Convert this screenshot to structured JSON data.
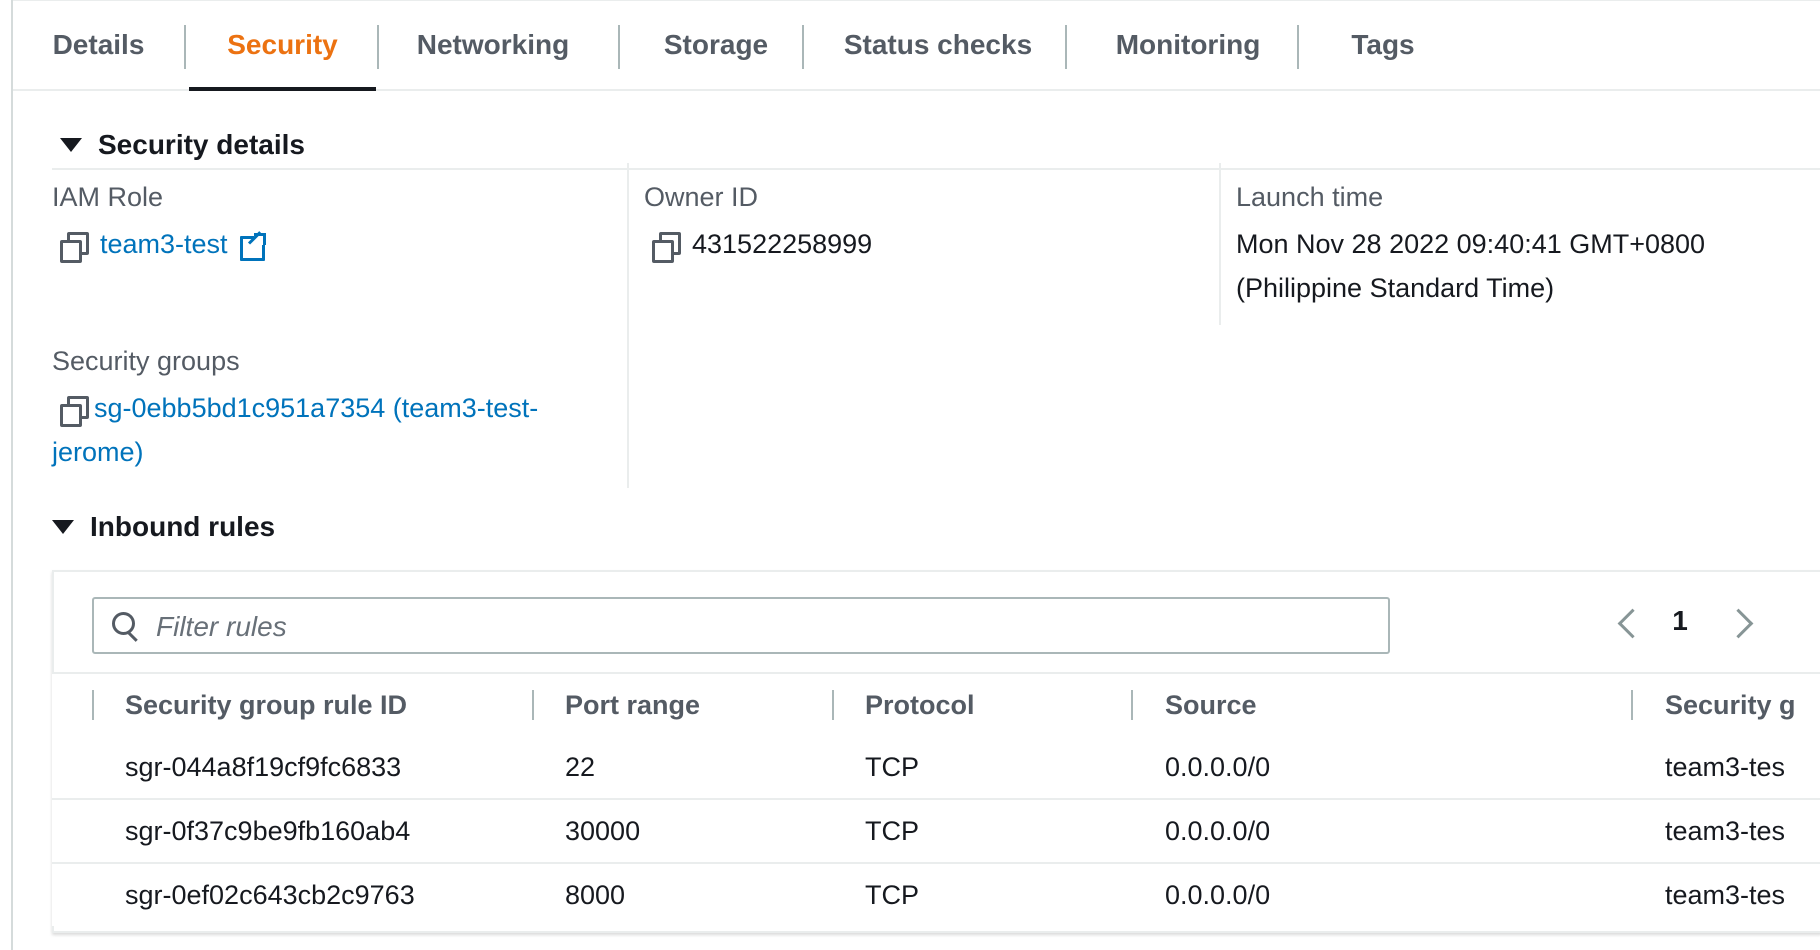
{
  "tabs": [
    {
      "label": "Details",
      "active": false
    },
    {
      "label": "Security",
      "active": true
    },
    {
      "label": "Networking",
      "active": false
    },
    {
      "label": "Storage",
      "active": false
    },
    {
      "label": "Status checks",
      "active": false
    },
    {
      "label": "Monitoring",
      "active": false
    },
    {
      "label": "Tags",
      "active": false
    }
  ],
  "security_details": {
    "heading": "Security details",
    "iam_role": {
      "label": "IAM Role",
      "value": "team3-test"
    },
    "owner_id": {
      "label": "Owner ID",
      "value": "431522258999"
    },
    "launch_time": {
      "label": "Launch time",
      "line1": "Mon Nov 28 2022 09:40:41 GMT+0800",
      "line2": "(Philippine Standard Time)"
    },
    "security_groups": {
      "label": "Security groups",
      "line1": "sg-0ebb5bd1c951a7354 (team3-test-",
      "line2": "jerome)"
    }
  },
  "inbound_rules": {
    "heading": "Inbound rules",
    "filter_placeholder": "Filter rules",
    "page": "1",
    "columns": [
      "Security group rule ID",
      "Port range",
      "Protocol",
      "Source",
      "Security g"
    ],
    "rows": [
      {
        "rule_id": "sgr-044a8f19cf9fc6833",
        "port_range": "22",
        "protocol": "TCP",
        "source": "0.0.0.0/0",
        "security_group": "team3-tes"
      },
      {
        "rule_id": "sgr-0f37c9be9fb160ab4",
        "port_range": "30000",
        "protocol": "TCP",
        "source": "0.0.0.0/0",
        "security_group": "team3-tes"
      },
      {
        "rule_id": "sgr-0ef02c643cb2c9763",
        "port_range": "8000",
        "protocol": "TCP",
        "source": "0.0.0.0/0",
        "security_group": "team3-tes"
      }
    ]
  },
  "colors": {
    "accent": "#ec7211",
    "link": "#0073bb",
    "text": "#16191f",
    "muted": "#545b64"
  }
}
